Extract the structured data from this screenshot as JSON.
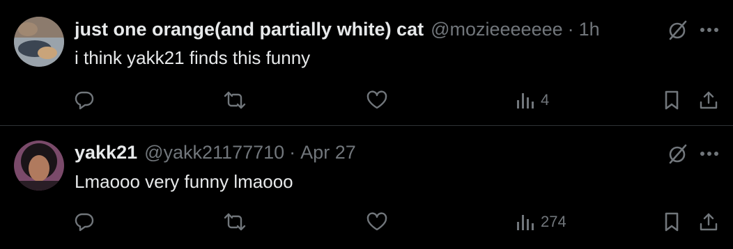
{
  "colors": {
    "background": "#000000",
    "primary_text": "#e7e9ea",
    "secondary_text": "#71767b",
    "divider": "#2f3336"
  },
  "tweets": [
    {
      "display_name": "just one orange(and partially white) cat",
      "handle": "@mozieeeeeee",
      "separator": "·",
      "time": "1h",
      "text": "i think yakk21 finds this funny",
      "views": "4",
      "avatar_icon": "cat-avatar"
    },
    {
      "display_name": "yakk21",
      "handle": "@yakk21177710",
      "separator": "·",
      "time": "Apr 27",
      "text": "Lmaooo very funny lmaooo",
      "views": "274",
      "avatar_icon": "person-avatar"
    }
  ],
  "icons": {
    "reply": "reply-icon",
    "repost": "repost-icon",
    "like": "like-icon",
    "views": "views-icon",
    "bookmark": "bookmark-icon",
    "share": "share-icon",
    "grok": "grok-icon",
    "more": "more-icon"
  }
}
